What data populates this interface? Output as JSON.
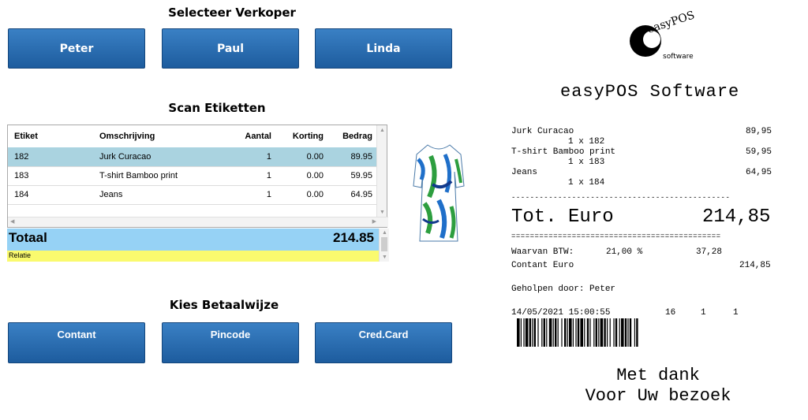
{
  "seller": {
    "title": "Selecteer Verkoper",
    "buttons": [
      "Peter",
      "Paul",
      "Linda"
    ]
  },
  "scan": {
    "title": "Scan Etiketten",
    "columns": [
      "Etiket",
      "Omschrijving",
      "Aantal",
      "Korting",
      "Bedrag"
    ],
    "rows": [
      {
        "etiket": "182",
        "omschrijving": "Jurk Curacao",
        "aantal": "1",
        "korting": "0.00",
        "bedrag": "89.95"
      },
      {
        "etiket": "183",
        "omschrijving": "T-shirt Bamboo print",
        "aantal": "1",
        "korting": "0.00",
        "bedrag": "59.95"
      },
      {
        "etiket": "184",
        "omschrijving": "Jeans",
        "aantal": "1",
        "korting": "0.00",
        "bedrag": "64.95"
      }
    ],
    "total_label": "Totaal",
    "total_value": "214.85",
    "relatie_label": "Relatie"
  },
  "payment": {
    "title": "Kies Betaalwijze",
    "buttons": [
      "Contant",
      "Pincode",
      "Cred.Card"
    ]
  },
  "receipt": {
    "logo_top": "easyPOS",
    "logo_bottom": "software",
    "heading": "easyPOS Software",
    "items": [
      {
        "name": "Jurk Curacao",
        "qty": "1 x 182",
        "amount": "89,95"
      },
      {
        "name": "T-shirt Bamboo print",
        "qty": "1 x 183",
        "amount": "59,95"
      },
      {
        "name": "Jeans",
        "qty": "1 x 184",
        "amount": "64,95"
      }
    ],
    "dashes": "-----------------------------------------------",
    "total_label": "Tot. Euro",
    "total_value": "214,85",
    "equals": "=============================================",
    "vat_label": "Waarvan BTW:",
    "vat_pct": "21,00 %",
    "vat_amount": "37,28",
    "paid_label": "Contant Euro",
    "paid_amount": "214,85",
    "helped_by": "Geholpen door: Peter",
    "datetime": "14/05/2021 15:00:55",
    "code1": "16",
    "code2": "1",
    "code3": "1",
    "thanks1": "Met dank",
    "thanks2": "Voor Uw bezoek"
  },
  "colors": {
    "button": "#2a6db3",
    "selected_row": "#aad3e0",
    "total_bar": "#96d2f5",
    "relatie_bar": "#fafa6e"
  }
}
